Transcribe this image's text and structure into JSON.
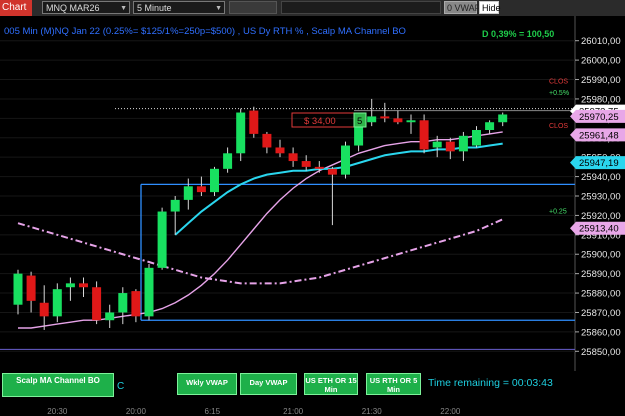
{
  "toolbar": {
    "chart_tag": "Chart",
    "symbol": "MNQ MAR26",
    "interval": "5 Minute",
    "vwap_button": "0 VWAP",
    "hide_button": "Hide"
  },
  "colors": {
    "bull": "#18e060",
    "bear": "#e01818",
    "fast_ma": "#2ad6ee",
    "slow_ma": "#e6a3e8",
    "channel": "#2f8fff",
    "accent_blue": "#2f6fff"
  },
  "chart_data": {
    "type": "candlestick",
    "title": "005 Min (M)NQ Jan 22 (0.25%= $125/1%=250p=$500) , US Dy RTH % , Scalp MA Channel BO",
    "ylim": [
      25845,
      26015
    ],
    "y_ticks": [
      25850,
      25860,
      25870,
      25880,
      25890,
      25900,
      25910,
      25920,
      25930,
      25940,
      25950,
      25960,
      25970,
      25980,
      25990,
      26000,
      26010
    ],
    "x_tick_labels": [
      "20:30",
      "20:00",
      "6:15",
      "21:00",
      "21:30",
      "22:00"
    ],
    "x_tick_indices": [
      3,
      9,
      15,
      21,
      27,
      33
    ],
    "candles": [
      {
        "o": 25874,
        "h": 25892,
        "l": 25869,
        "c": 25890
      },
      {
        "o": 25889,
        "h": 25891,
        "l": 25870,
        "c": 25876
      },
      {
        "o": 25875,
        "h": 25884,
        "l": 25861,
        "c": 25868
      },
      {
        "o": 25868,
        "h": 25885,
        "l": 25865,
        "c": 25882
      },
      {
        "o": 25883,
        "h": 25888,
        "l": 25876,
        "c": 25885
      },
      {
        "o": 25885,
        "h": 25888,
        "l": 25878,
        "c": 25883
      },
      {
        "o": 25883,
        "h": 25886,
        "l": 25864,
        "c": 25866
      },
      {
        "o": 25866,
        "h": 25874,
        "l": 25862,
        "c": 25870
      },
      {
        "o": 25870,
        "h": 25883,
        "l": 25864,
        "c": 25880
      },
      {
        "o": 25881,
        "h": 25882,
        "l": 25865,
        "c": 25868
      },
      {
        "o": 25868,
        "h": 25895,
        "l": 25866,
        "c": 25893
      },
      {
        "o": 25893,
        "h": 25924,
        "l": 25892,
        "c": 25922
      },
      {
        "o": 25922,
        "h": 25930,
        "l": 25910,
        "c": 25928
      },
      {
        "o": 25928,
        "h": 25939,
        "l": 25923,
        "c": 25935
      },
      {
        "o": 25935,
        "h": 25940,
        "l": 25930,
        "c": 25932
      },
      {
        "o": 25932,
        "h": 25945,
        "l": 25930,
        "c": 25944
      },
      {
        "o": 25944,
        "h": 25955,
        "l": 25942,
        "c": 25952
      },
      {
        "o": 25952,
        "h": 25975,
        "l": 25948,
        "c": 25973
      },
      {
        "o": 25974,
        "h": 25976,
        "l": 25960,
        "c": 25962
      },
      {
        "o": 25962,
        "h": 25963,
        "l": 25952,
        "c": 25955
      },
      {
        "o": 25955,
        "h": 25959,
        "l": 25950,
        "c": 25952
      },
      {
        "o": 25952,
        "h": 25955,
        "l": 25945,
        "c": 25948
      },
      {
        "o": 25948,
        "h": 25951,
        "l": 25943,
        "c": 25945
      },
      {
        "o": 25945,
        "h": 25948,
        "l": 25942,
        "c": 25944
      },
      {
        "o": 25944,
        "h": 25945,
        "l": 25915,
        "c": 25941
      },
      {
        "o": 25941,
        "h": 25958,
        "l": 25939,
        "c": 25956
      },
      {
        "o": 25956,
        "h": 25970,
        "l": 25953,
        "c": 25967
      },
      {
        "o": 25968,
        "h": 25980,
        "l": 25966,
        "c": 25971
      },
      {
        "o": 25971,
        "h": 25978,
        "l": 25968,
        "c": 25970
      },
      {
        "o": 25970,
        "h": 25974,
        "l": 25967,
        "c": 25968
      },
      {
        "o": 25968,
        "h": 25972,
        "l": 25962,
        "c": 25969
      },
      {
        "o": 25969,
        "h": 25972,
        "l": 25952,
        "c": 25954
      },
      {
        "o": 25955,
        "h": 25961,
        "l": 25950,
        "c": 25958
      },
      {
        "o": 25958,
        "h": 25960,
        "l": 25949,
        "c": 25953
      },
      {
        "o": 25953,
        "h": 25963,
        "l": 25948,
        "c": 25961
      },
      {
        "o": 25956,
        "h": 25966,
        "l": 25955,
        "c": 25964
      },
      {
        "o": 25964,
        "h": 25969,
        "l": 25962,
        "c": 25968
      },
      {
        "o": 25968,
        "h": 25973,
        "l": 25966,
        "c": 25972
      }
    ],
    "fast_ma": [
      null,
      null,
      null,
      null,
      null,
      null,
      null,
      null,
      null,
      null,
      null,
      null,
      25910,
      25916,
      25922,
      25927,
      25932,
      25936,
      25939,
      25941,
      25942,
      25943,
      25943,
      25944,
      25944,
      25945,
      25947,
      25949,
      25951,
      25952,
      25953,
      25953,
      25954,
      25954,
      25955,
      25955,
      25956,
      25957
    ],
    "slow_ma": [
      25862,
      25862,
      25863,
      25864,
      25865,
      25866,
      25866,
      25867,
      25868,
      25869,
      25870,
      25872,
      25875,
      25879,
      25884,
      25890,
      25897,
      25905,
      25913,
      25921,
      25928,
      25934,
      25939,
      25943,
      25946,
      25949,
      25952,
      25954,
      25956,
      25957,
      25958,
      25958,
      25959,
      25959,
      25960,
      25961,
      25962,
      25963
    ],
    "lower_ma": [
      25916,
      25914,
      25912,
      25910,
      25908,
      25906,
      25904,
      25902,
      25900,
      25898,
      25896,
      25894,
      25892,
      25890,
      25888,
      25887,
      25886,
      25885,
      25885,
      25885,
      25885,
      25886,
      25887,
      25888,
      25890,
      25892,
      25894,
      25896,
      25898,
      25900,
      25902,
      25904,
      25906,
      25908,
      25910,
      25912,
      25915,
      25918
    ],
    "channel_box": {
      "i0": 10,
      "i1": 38,
      "top": 25936,
      "bottom": 25866
    },
    "lines": {
      "dotted_level": 25975,
      "gray_level": 25974,
      "bottom_band": 25851
    },
    "price_labels": [
      {
        "value": "25973,75",
        "price": 25973.75,
        "bg": "#ffffff"
      },
      {
        "value": "25970,25",
        "price": 25971,
        "bg": "#e8a7e8"
      },
      {
        "value": "25961,48",
        "price": 25961.48,
        "bg": "#e8a7e8"
      },
      {
        "value": "25947,19",
        "price": 25947.19,
        "bg": "#2ad6ee"
      },
      {
        "value": "25913,40",
        "price": 25913.4,
        "bg": "#e8a7e8"
      }
    ],
    "axis_notes": [
      {
        "text": "CLOS",
        "price": 25989,
        "color": "red"
      },
      {
        "text": "+0.5%",
        "price": 25983,
        "color": "green"
      },
      {
        "text": "CLOS",
        "price": 25966,
        "color": "red"
      },
      {
        "text": "+0.25",
        "price": 25922,
        "color": "green"
      }
    ],
    "badge": "D 0,39% = 100,50",
    "position": {
      "pl": "$ 34,00",
      "qty": "5"
    }
  },
  "bottom": {
    "scalp_button": "Scalp MA Channel BO",
    "wkly_vwap": "Wkly VWAP",
    "day_vwap": "Day VWAP",
    "us_eth": "US ETH OR 15 Min",
    "us_rth": "US RTH OR 5 Min",
    "c_letter": "C",
    "time_remaining": "Time remaining = 00:03:43"
  }
}
